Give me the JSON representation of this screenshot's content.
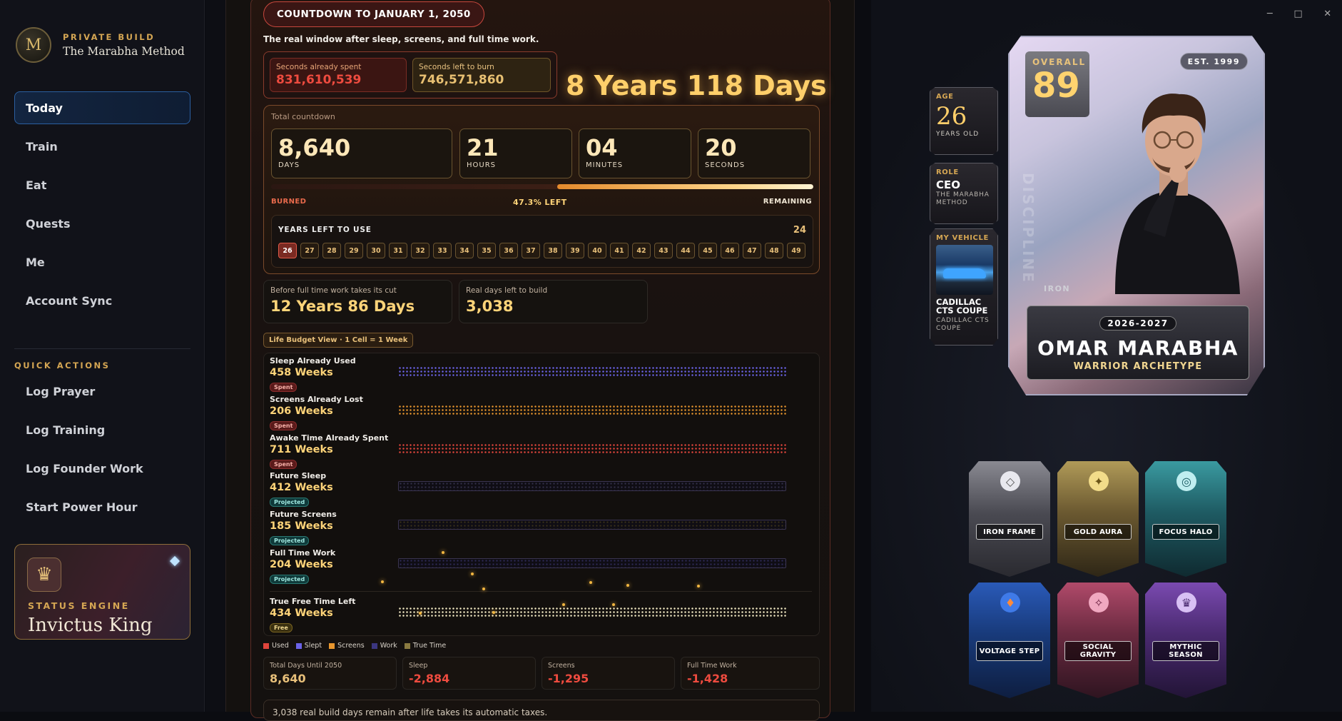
{
  "window": {
    "minimize": "─",
    "maximize": "□",
    "close": "✕"
  },
  "sidebar": {
    "brand_mark": "M",
    "brand_sub": "PRIVATE BUILD",
    "brand_title": "The Marabha Method",
    "nav": [
      {
        "label": "Today",
        "active": true
      },
      {
        "label": "Train"
      },
      {
        "label": "Eat"
      },
      {
        "label": "Quests"
      },
      {
        "label": "Me"
      },
      {
        "label": "Account Sync"
      }
    ],
    "quick_actions_title": "QUICK ACTIONS",
    "quick_actions": [
      "Log Prayer",
      "Log Training",
      "Log Founder Work",
      "Start Power Hour"
    ],
    "status": {
      "icon": "crown-icon",
      "label": "STATUS ENGINE",
      "title": "Invictus King"
    }
  },
  "countdown": {
    "pill": "COUNTDOWN TO JANUARY 1, 2050",
    "tagline": "The real window after sleep, screens, and full time work.",
    "spent_label": "Seconds already spent",
    "spent_value": "831,610,539",
    "left_label": "Seconds left to burn",
    "left_value": "746,571,860",
    "headline": "8 Years 118 Days",
    "total_label": "Total countdown",
    "units": [
      {
        "value": "8,640",
        "label": "DAYS"
      },
      {
        "value": "21",
        "label": "HOURS"
      },
      {
        "value": "04",
        "label": "MINUTES"
      },
      {
        "value": "20",
        "label": "SECONDS"
      }
    ],
    "progress_remaining_fraction": 0.473,
    "burned_label": "BURNED",
    "left_pct_label": "47.3% LEFT",
    "remaining_label": "REMAINING",
    "years_title": "YEARS LEFT TO USE",
    "years_count": "24",
    "years": [
      "26",
      "27",
      "28",
      "29",
      "30",
      "31",
      "32",
      "33",
      "34",
      "35",
      "36",
      "37",
      "38",
      "39",
      "40",
      "41",
      "42",
      "43",
      "44",
      "45",
      "46",
      "47",
      "48",
      "49"
    ],
    "current_year": "26"
  },
  "before_work": {
    "label": "Before full time work takes its cut",
    "value": "12 Years 86 Days"
  },
  "real_days": {
    "label": "Real days left to build",
    "value": "3,038"
  },
  "life_budget": {
    "label": "Life Budget View · 1 Cell = 1 Week",
    "rows": [
      {
        "name": "Sleep Already Used",
        "weeks": "458 Weeks",
        "tag": "Spent",
        "kind": "spent",
        "color": "#6b63e8"
      },
      {
        "name": "Screens Already Lost",
        "weeks": "206 Weeks",
        "tag": "Spent",
        "kind": "spent",
        "color": "#e8962e"
      },
      {
        "name": "Awake Time Already Spent",
        "weeks": "711 Weeks",
        "tag": "Spent",
        "kind": "spent",
        "color": "#e0453c"
      },
      {
        "name": "Future Sleep",
        "weeks": "412 Weeks",
        "tag": "Projected",
        "kind": "proj",
        "color": "#34304a"
      },
      {
        "name": "Future Screens",
        "weeks": "185 Weeks",
        "tag": "Projected",
        "kind": "proj",
        "color": "#3a321a"
      },
      {
        "name": "Full Time Work",
        "weeks": "204 Weeks",
        "tag": "Projected",
        "kind": "proj",
        "color": "#2e2a58"
      },
      {
        "name": "True Free Time Left",
        "weeks": "434 Weeks",
        "tag": "Free",
        "kind": "free",
        "color": "#f4ebc4"
      }
    ],
    "legend": [
      {
        "label": "Used",
        "color": "#e0453c"
      },
      {
        "label": "Slept",
        "color": "#6b63e8"
      },
      {
        "label": "Screens",
        "color": "#e8962e"
      },
      {
        "label": "Work",
        "color": "#3b3680"
      },
      {
        "label": "True Time",
        "color": "#8a7a40"
      }
    ]
  },
  "totals": [
    {
      "label": "Total Days Until 2050",
      "value": "8,640",
      "color": "#e8c07a"
    },
    {
      "label": "Sleep",
      "value": "-2,884",
      "color": "#ee4b3f"
    },
    {
      "label": "Screens",
      "value": "-1,295",
      "color": "#ee4b3f"
    },
    {
      "label": "Full Time Work",
      "value": "-1,428",
      "color": "#ee4b3f"
    }
  ],
  "bottom_note": "3,038 real build days remain after life takes its automatic taxes.",
  "profile": {
    "age_label": "AGE",
    "age": "26",
    "age_sub": "YEARS OLD",
    "role_label": "ROLE",
    "role": "CEO",
    "role_sub": "THE MARABHA METHOD",
    "vehicle_label": "MY VEHICLE",
    "vehicle": "CADILLAC CTS COUPE",
    "vehicle_sub": "CADILLAC CTS COUPE",
    "overall_label": "OVERALL",
    "overall": "89",
    "est": "EST. 1999",
    "discipline": "DISCIPLINE",
    "tier": "IRON",
    "season": "2026-2027",
    "name": "OMAR MARABHA",
    "archetype": "WARRIOR ARCHETYPE"
  },
  "badges": [
    {
      "label": "IRON FRAME",
      "icon": "diamond-icon",
      "glyph": "◇"
    },
    {
      "label": "GOLD AURA",
      "icon": "sparkle-icon",
      "glyph": "✦"
    },
    {
      "label": "FOCUS HALO",
      "icon": "target-icon",
      "glyph": "◎"
    },
    {
      "label": "VOLTAGE STEP",
      "icon": "flame-icon",
      "glyph": "♦"
    },
    {
      "label": "SOCIAL GRAVITY",
      "icon": "star-icon",
      "glyph": "✧"
    },
    {
      "label": "MYTHIC SEASON",
      "icon": "crown-icon",
      "glyph": "♛"
    }
  ]
}
